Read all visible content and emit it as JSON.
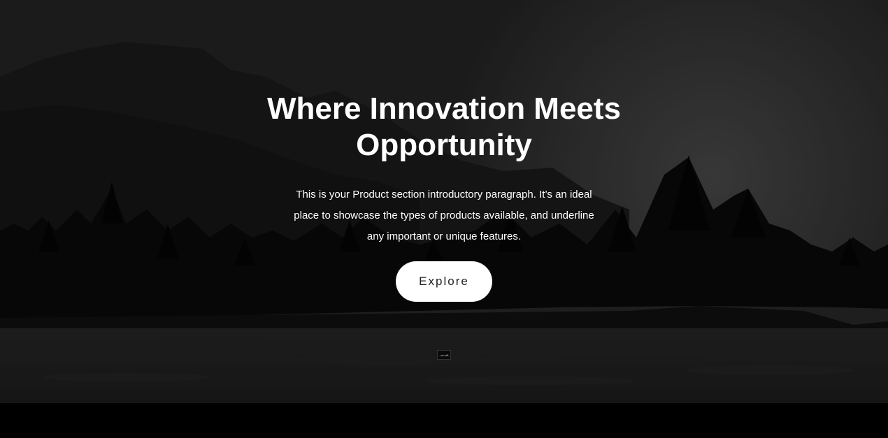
{
  "hero": {
    "headline": "Where Innovation Meets Opportunity",
    "intro": "This is your Product section introductory paragraph. It’s an ideal place to showcase the types of products available, and underline any important or unique features.",
    "button_label": "Explore",
    "background_image": "mountain-forest-night-illustration",
    "colors": {
      "text": "#ffffff",
      "button_bg": "#ffffff",
      "button_text": "#222222",
      "overlay": "#2a2a2a"
    }
  },
  "thumbnail": {
    "icon": "image-thumbnail-icon"
  }
}
